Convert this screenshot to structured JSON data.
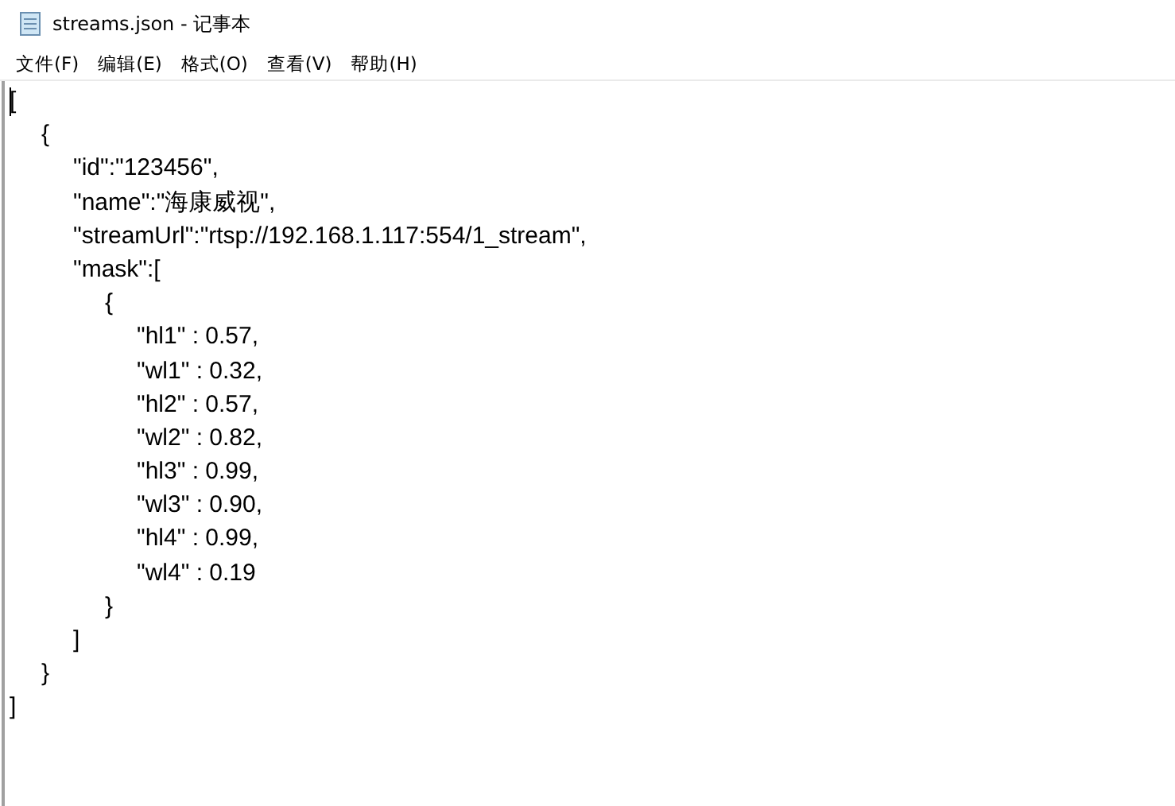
{
  "window": {
    "title": "streams.json - 记事本"
  },
  "menu": [
    "文件(F)",
    "编辑(E)",
    "格式(O)",
    "查看(V)",
    "帮助(H)"
  ],
  "editor": {
    "lines": [
      "[",
      "\t{",
      "\t\t\"id\":\"123456\",",
      "\t\t\"name\":\"海康威视\",",
      "\t\t\"streamUrl\":\"rtsp://192.168.1.117:554/1_stream\",",
      "\t\t\"mask\":[",
      "\t\t\t{",
      "\t\t\t\t\"hl1\" : 0.57,",
      "\t\t\t\t\"wl1\" : 0.32,",
      "\t\t\t\t\"hl2\" : 0.57,",
      "\t\t\t\t\"wl2\" : 0.82,",
      "\t\t\t\t\"hl3\" : 0.99,",
      "\t\t\t\t\"wl3\" : 0.90,",
      "\t\t\t\t\"hl4\" : 0.99,",
      "\t\t\t\t\"wl4\" : 0.19",
      "\t\t\t}",
      "\t\t]",
      "\t}",
      "]"
    ]
  }
}
